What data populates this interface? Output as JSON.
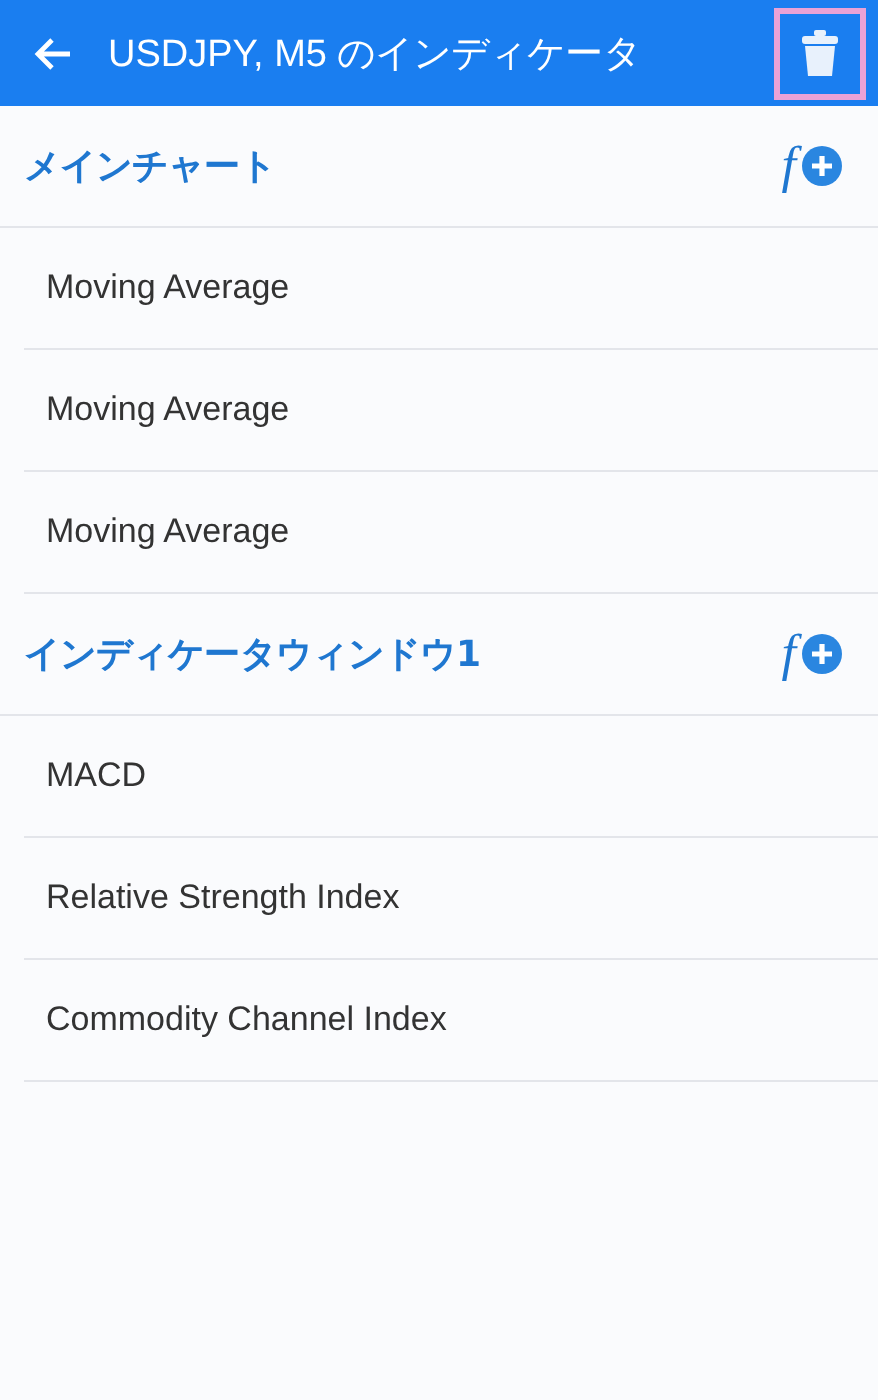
{
  "app_bar": {
    "title": "USDJPY, M5 のインディケータ",
    "delete_highlighted": true
  },
  "sections": [
    {
      "title": "メインチャート",
      "add_glyph": "f",
      "items": [
        "Moving Average",
        "Moving Average",
        "Moving Average"
      ]
    },
    {
      "title": "インディケータウィンドウ1",
      "add_glyph": "f",
      "items": [
        "MACD",
        "Relative Strength Index",
        "Commodity Channel Index"
      ]
    }
  ]
}
